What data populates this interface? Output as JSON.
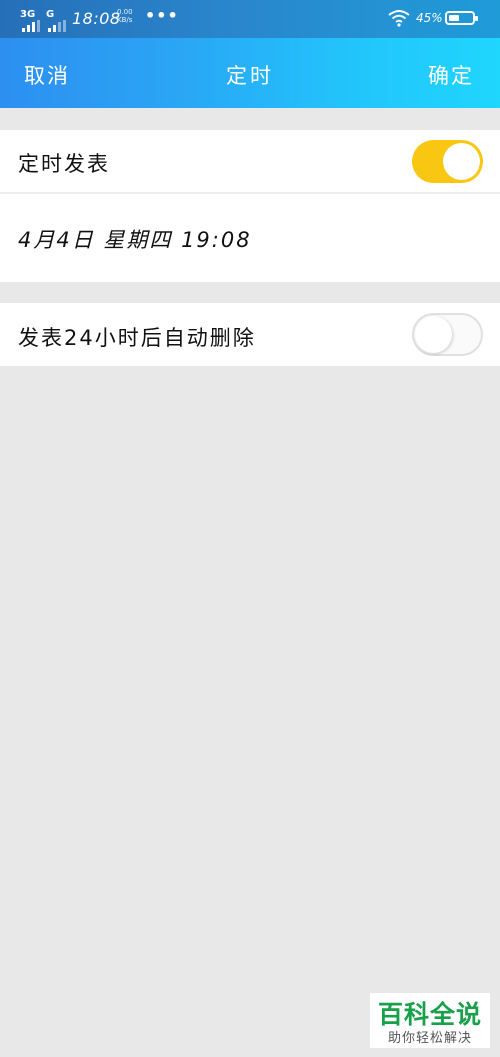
{
  "status_bar": {
    "network1": "3G",
    "network2": "G",
    "time": "18:08",
    "speed_value": "0.00",
    "speed_unit": "KB/s",
    "more": "•••",
    "battery_percent": "45%",
    "battery_level": 0.45
  },
  "header": {
    "cancel_label": "取消",
    "title": "定时",
    "confirm_label": "确定"
  },
  "settings": {
    "schedule_label": "定时发表",
    "schedule_enabled": true,
    "datetime": "4月4日  星期四  19:08",
    "auto_delete_label": "发表24小时后自动删除",
    "auto_delete_enabled": false
  },
  "watermark": {
    "title": "百科全说",
    "subtitle": "助你轻松解决"
  },
  "colors": {
    "toggle_on": "#f9c712",
    "header_gradient_start": "#2d8ff0",
    "header_gradient_end": "#1fd6fd",
    "watermark_green": "#19a04a"
  },
  "icons": [
    "signal-icon",
    "wifi-icon",
    "battery-icon"
  ]
}
